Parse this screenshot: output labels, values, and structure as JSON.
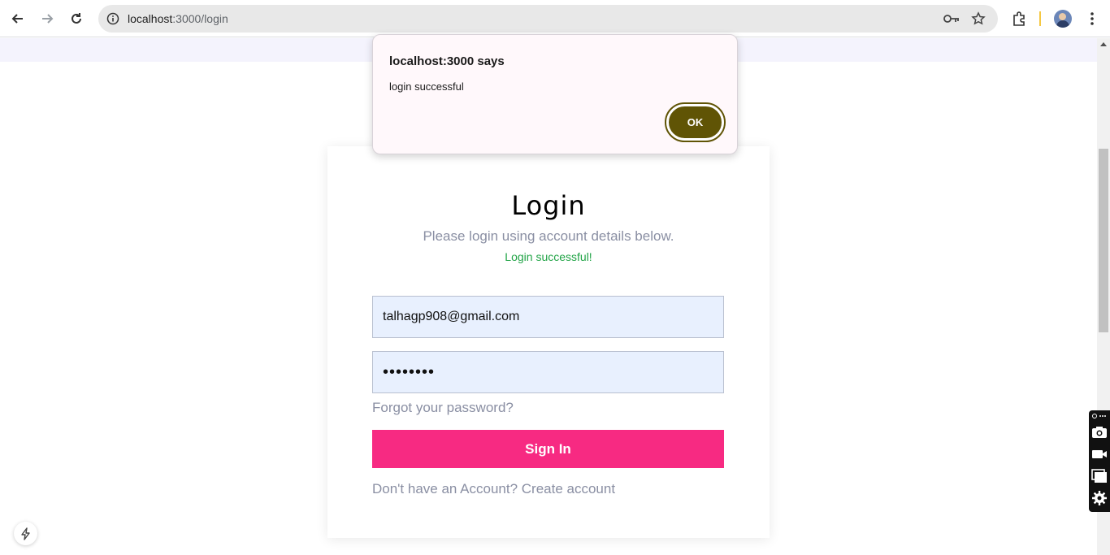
{
  "browser": {
    "url_host": "localhost",
    "url_path": ":3000/login"
  },
  "dialog": {
    "title": "localhost:3000 says",
    "message": "login successful",
    "ok_label": "OK"
  },
  "login": {
    "title": "Login",
    "subtitle": "Please login using account details below.",
    "status": "Login successful!",
    "email_value": "talhagp908@gmail.com",
    "password_value": "••••••••",
    "forgot_label": "Forgot your password?",
    "signin_label": "Sign In",
    "create_label": "Don't have an Account? Create account"
  },
  "colors": {
    "accent": "#f72a82",
    "success": "#22a447",
    "dialog_button": "#605405"
  },
  "icons": {
    "back": "arrow-left-icon",
    "forward": "arrow-right-icon",
    "reload": "reload-icon",
    "site_info": "info-icon",
    "password_key": "key-icon",
    "bookmark": "star-icon",
    "extensions": "puzzle-icon",
    "menu": "kebab-menu-icon",
    "next_badge": "lightning-icon"
  }
}
